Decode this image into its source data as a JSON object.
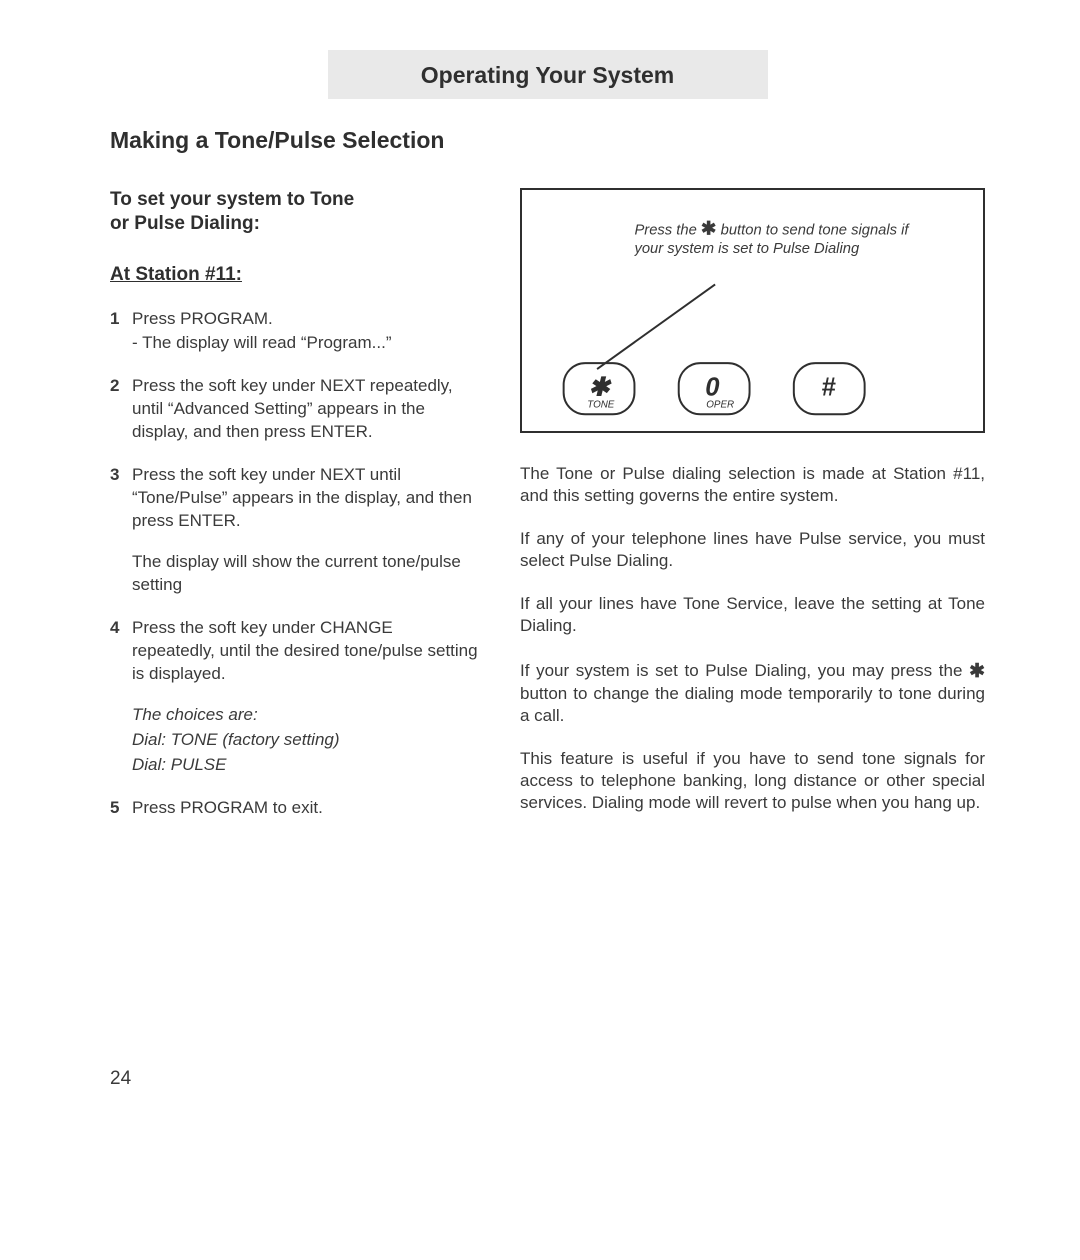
{
  "header": "Operating Your System",
  "section_title": "Making a Tone/Pulse Selection",
  "left": {
    "subhead_l1": "To set your system to Tone",
    "subhead_l2": "or Pulse Dialing:",
    "station": "At Station #11:",
    "steps": [
      {
        "num": "1",
        "lines": [
          "Press PROGRAM.",
          "- The display will read “Program...”"
        ]
      },
      {
        "num": "2",
        "lines": [
          "Press the soft key under NEXT repeatedly, until “Advanced Setting” appears in the display, and then press ENTER."
        ]
      },
      {
        "num": "3",
        "lines": [
          "Press the soft key under NEXT until “Tone/Pulse” appears in the display, and then press ENTER."
        ],
        "after": [
          "The display will show the current tone/pulse setting"
        ]
      },
      {
        "num": "4",
        "lines": [
          "Press the soft key under CHANGE repeatedly, until the desired tone/pulse setting is displayed."
        ],
        "italic_after": [
          "The choices are:",
          "Dial: TONE (factory setting)",
          "Dial: PULSE"
        ]
      },
      {
        "num": "5",
        "lines": [
          "Press PROGRAM to exit."
        ]
      }
    ]
  },
  "diagram": {
    "tip_pre": "Press the ",
    "tip_post": " button to send tone signals if your system is set to Pulse Dialing",
    "keys": [
      {
        "main": "✱",
        "sub": "TONE"
      },
      {
        "main": "0",
        "sub": "OPER"
      },
      {
        "main": "#",
        "sub": ""
      }
    ]
  },
  "right_paras": [
    "The Tone or Pulse dialing selection is made at Station #11, and this setting governs the entire system.",
    "If any of your telephone lines have Pulse service, you must select Pulse Dialing.",
    "If all your lines have Tone Service, leave the setting at Tone Dialing."
  ],
  "right_star_para_pre": "If your system is set to Pulse Dialing, you may press the ",
  "right_star_para_post": " button to change the dialing mode temporarily to tone during a call.",
  "right_last": "This feature is useful if you have to send tone signals for access to telephone banking, long distance or other special services.  Dialing mode will revert to pulse when you hang up.",
  "page_number": "24"
}
